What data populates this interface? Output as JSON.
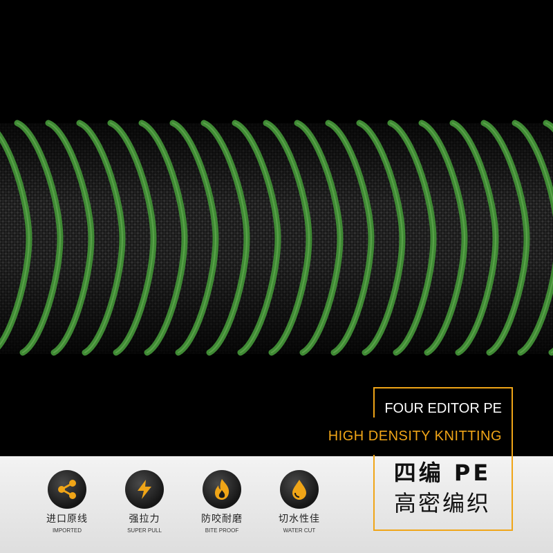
{
  "banner": {
    "title_en": "FOUR EDITOR PE",
    "subtitle_en": "HIGH DENSITY KNITTING",
    "title_cn": "四编 PE",
    "subtitle_cn": "高密编织"
  },
  "features": [
    {
      "cn": "进口原线",
      "en": "IMPORTED",
      "icon": "share-icon"
    },
    {
      "cn": "强拉力",
      "en": "SUPER PULL",
      "icon": "lightning-icon"
    },
    {
      "cn": "防咬耐磨",
      "en": "BITE PROOF",
      "icon": "flame-icon"
    },
    {
      "cn": "切水性佳",
      "en": "WATER CUT",
      "icon": "water-drop-icon"
    }
  ],
  "colors": {
    "accent": "#f0a517",
    "line": "#3f8a34",
    "background": "#000000"
  }
}
